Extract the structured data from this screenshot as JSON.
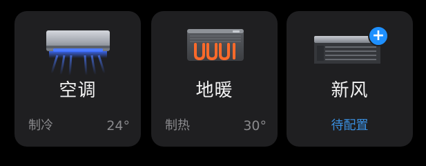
{
  "devices": [
    {
      "name": "空调",
      "status": "制冷",
      "value": "24°",
      "icon": "air-conditioner-icon"
    },
    {
      "name": "地暖",
      "status": "制热",
      "value": "30°",
      "icon": "floor-heating-icon"
    },
    {
      "name": "新风",
      "status": "待配置",
      "icon": "fresh-air-icon",
      "badge": "+"
    }
  ],
  "colors": {
    "background": "#000000",
    "card": "#1f1f21",
    "title_text": "#f2f2f2",
    "secondary_text": "#8a8a8d",
    "accent": "#3a8fe0",
    "badge": "#1e90ff",
    "heat_glow": "#ff6a2a",
    "cool_glow": "#3c6cff"
  }
}
